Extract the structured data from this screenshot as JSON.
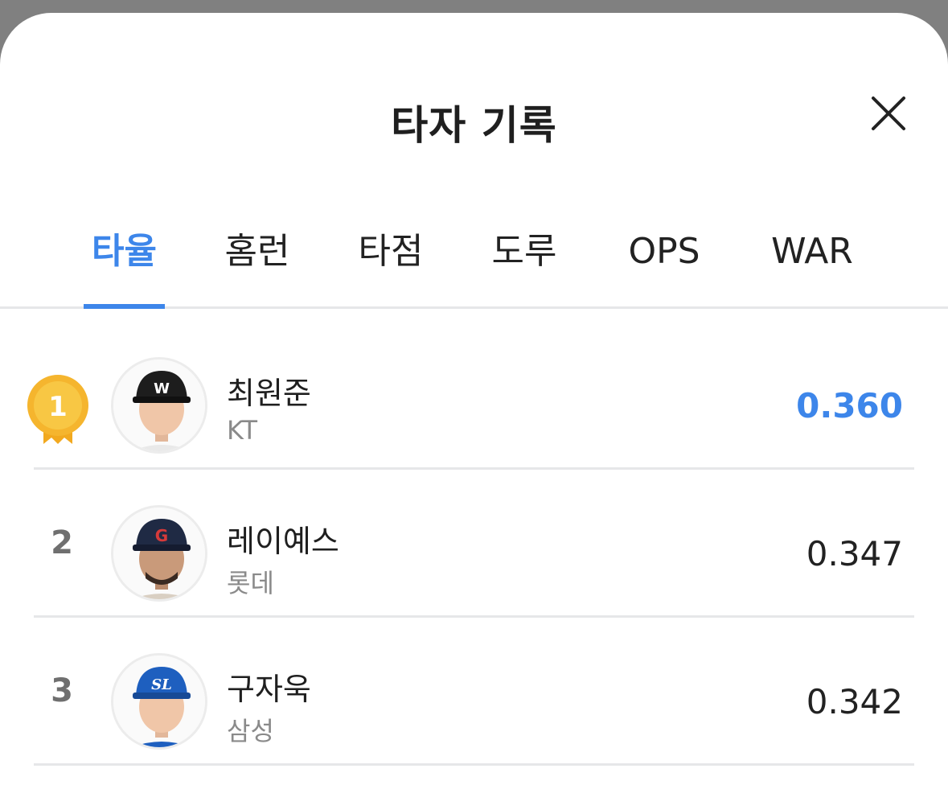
{
  "header": {
    "title": "타자 기록",
    "close_icon": "close-icon"
  },
  "tabs": [
    {
      "label": "타율",
      "active": true
    },
    {
      "label": "홈런",
      "active": false
    },
    {
      "label": "타점",
      "active": false
    },
    {
      "label": "도루",
      "active": false
    },
    {
      "label": "OPS",
      "active": false
    },
    {
      "label": "WAR",
      "active": false
    }
  ],
  "players": [
    {
      "rank": "1",
      "name": "최원준",
      "team": "KT",
      "value": "0.360",
      "cap_logo": "kt-cap-logo",
      "cap_color": "#1d1d1d"
    },
    {
      "rank": "2",
      "name": "레이예스",
      "team": "롯데",
      "value": "0.347",
      "cap_logo": "giants-cap-logo",
      "cap_color": "#1f2a44"
    },
    {
      "rank": "3",
      "name": "구자욱",
      "team": "삼성",
      "value": "0.342",
      "cap_logo": "lions-cap-logo",
      "cap_color": "#1e5fbf"
    }
  ],
  "colors": {
    "accent": "#3d86ea",
    "medal_gold": "#f5b52e"
  }
}
